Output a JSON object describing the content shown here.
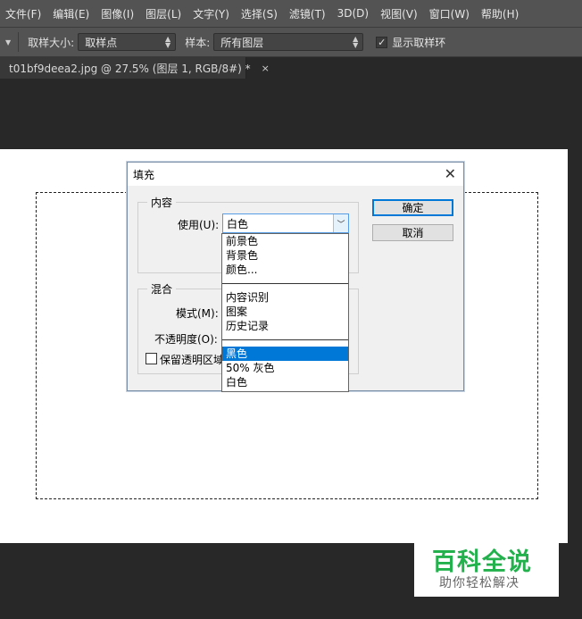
{
  "menubar": {
    "items": [
      "文件(F)",
      "编辑(E)",
      "图像(I)",
      "图层(L)",
      "文字(Y)",
      "选择(S)",
      "滤镜(T)",
      "3D(D)",
      "视图(V)",
      "窗口(W)",
      "帮助(H)"
    ]
  },
  "options": {
    "sample_size_label": "取样大小:",
    "sample_size_value": "取样点",
    "sample_label": "样本:",
    "sample_value": "所有图层",
    "show_ring_label": "显示取样环",
    "show_ring_checked": true
  },
  "document": {
    "tab_title": "t01bf9deea2.jpg @ 27.5% (图层 1, RGB/8#) *",
    "close_glyph": "×"
  },
  "dialog": {
    "title": "填充",
    "close_glyph": "✕",
    "content_group": "内容",
    "use_label": "使用(U):",
    "use_value": "白色",
    "blend_group": "混合",
    "mode_label": "模式(M):",
    "opacity_label": "不透明度(O):",
    "preserve_label": "保留透明区域",
    "ok_label": "确定",
    "cancel_label": "取消"
  },
  "dropdown": {
    "group1": [
      "前景色",
      "背景色",
      "颜色..."
    ],
    "group2": [
      "内容识别",
      "图案",
      "历史记录"
    ],
    "group3": [
      "黑色",
      "50% 灰色",
      "白色"
    ],
    "selected": "黑色"
  },
  "watermark": {
    "title": "百科全说",
    "subtitle": "助你轻松解决"
  },
  "colors": {
    "accent": "#0078d7",
    "watermark_green": "#22b14c"
  }
}
